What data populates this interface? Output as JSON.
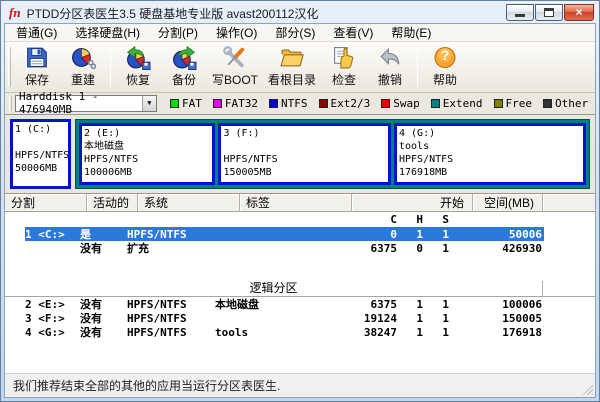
{
  "icons": {
    "close": "×",
    "dropdown": "▼",
    "question": "?"
  },
  "window": {
    "logo_text": "fn",
    "title": "PTDD分区表医生3.5 硬盘基地专业版 avast200112汉化"
  },
  "menu": {
    "items": [
      "普通(G)",
      "选择硬盘(H)",
      "分割(P)",
      "操作(O)",
      "部分(S)",
      "查看(V)",
      "帮助(E)"
    ]
  },
  "toolbar": {
    "buttons": [
      {
        "label": "保存",
        "icon": "floppy-disk-icon"
      },
      {
        "label": "重建",
        "icon": "pie-chart-icon"
      },
      {
        "label": "恢复",
        "icon": "pie-restore-arrow-icon"
      },
      {
        "label": "备份",
        "icon": "pie-backup-arrow-icon"
      },
      {
        "label": "写BOOT",
        "icon": "wrench-screwdriver-icon"
      },
      {
        "label": "看根目录",
        "icon": "folder-icon"
      },
      {
        "label": "检查",
        "icon": "pointing-hand-icon"
      },
      {
        "label": "撤销",
        "icon": "undo-arrow-icon"
      },
      {
        "label": "帮助",
        "icon": "question-mark-icon"
      }
    ]
  },
  "disk_selector": {
    "value": "Harddisk 1 - 476940MB"
  },
  "legend": {
    "items": [
      {
        "label": "FAT",
        "color": "#00dd00"
      },
      {
        "label": "FAT32",
        "color": "#ee00ee"
      },
      {
        "label": "NTFS",
        "color": "#0000dd"
      },
      {
        "label": "Ext2/3",
        "color": "#8b0000"
      },
      {
        "label": "Swap",
        "color": "#ee0000"
      },
      {
        "label": "Extend",
        "color": "#008080"
      },
      {
        "label": "Free",
        "color": "#808000"
      },
      {
        "label": "Other",
        "color": "#333333"
      }
    ]
  },
  "disk_map": {
    "primary": {
      "name": "1 (C:)",
      "label": "",
      "fs": "HPFS/NTFS",
      "size": "50006MB"
    },
    "extended": [
      {
        "name": "2 (E:)",
        "label": "本地磁盘",
        "fs": "HPFS/NTFS",
        "size": "100006MB"
      },
      {
        "name": "3 (F:)",
        "label": "",
        "fs": "HPFS/NTFS",
        "size": "150005MB"
      },
      {
        "name": "4 (G:)",
        "label": "tools",
        "fs": "HPFS/NTFS",
        "size": "176918MB"
      }
    ]
  },
  "table": {
    "headers": {
      "part": "分割",
      "active": "活动的",
      "system": "系统",
      "label": "标签",
      "start": "开始",
      "space": "空间(MB)"
    },
    "chs": {
      "c": "C",
      "h": "H",
      "s": "S"
    },
    "primary_rows": [
      {
        "part": "1 <C:>",
        "active": "是",
        "system": "HPFS/NTFS",
        "label": "",
        "c": "0",
        "h": "1",
        "s": "1",
        "space": "50006"
      },
      {
        "part": "",
        "active": "没有",
        "system": "扩充",
        "label": "",
        "c": "6375",
        "h": "0",
        "s": "1",
        "space": "426930"
      }
    ],
    "section_label": "逻辑分区",
    "logical_rows": [
      {
        "part": "2 <E:>",
        "active": "没有",
        "system": "HPFS/NTFS",
        "label": "本地磁盘",
        "c": "6375",
        "h": "1",
        "s": "1",
        "space": "100006"
      },
      {
        "part": "3 <F:>",
        "active": "没有",
        "system": "HPFS/NTFS",
        "label": "",
        "c": "19124",
        "h": "1",
        "s": "1",
        "space": "150005"
      },
      {
        "part": "4 <G:>",
        "active": "没有",
        "system": "HPFS/NTFS",
        "label": "tools",
        "c": "38247",
        "h": "1",
        "s": "1",
        "space": "176918"
      }
    ]
  },
  "status_bar": {
    "text": "我们推荐结束全部的其他的应用当运行分区表医生."
  }
}
